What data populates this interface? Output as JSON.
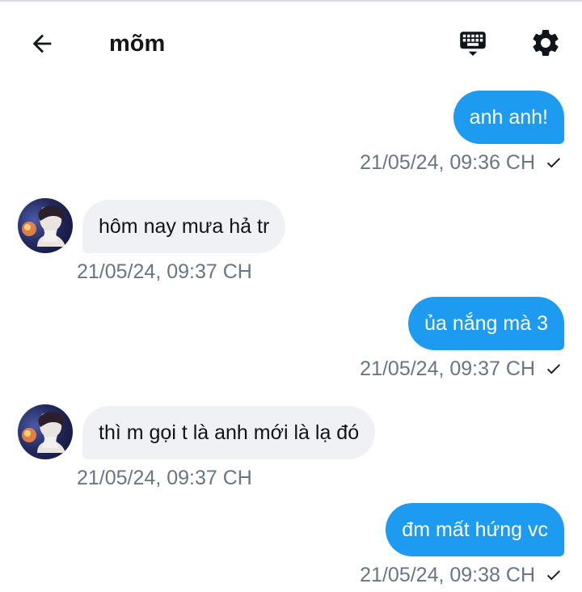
{
  "header": {
    "title": "mõm",
    "back_icon": "arrow-left-icon",
    "keyboard_icon": "keyboard-icon",
    "settings_icon": "gear-icon"
  },
  "messages": [
    {
      "direction": "sent",
      "text": "anh anh!",
      "time": "21/05/24, 09:36 CH",
      "status_icon": "checkmark-icon"
    },
    {
      "direction": "received",
      "text": "hôm nay mưa hả tr",
      "time": "21/05/24, 09:37 CH",
      "avatar": "contact-avatar"
    },
    {
      "direction": "sent",
      "text": "ủa nắng mà 3",
      "time": "21/05/24, 09:37 CH",
      "status_icon": "checkmark-icon"
    },
    {
      "direction": "received",
      "text": "thì m gọi t là anh mới là lạ đó",
      "time": "21/05/24, 09:37 CH",
      "avatar": "contact-avatar"
    },
    {
      "direction": "sent",
      "text": "đm mất hứng vc",
      "time": "21/05/24, 09:38 CH",
      "status_icon": "checkmark-icon"
    }
  ],
  "colors": {
    "sent_bubble": "#1d9bf0",
    "received_bubble": "#eff1f4",
    "timestamp": "#687684"
  }
}
